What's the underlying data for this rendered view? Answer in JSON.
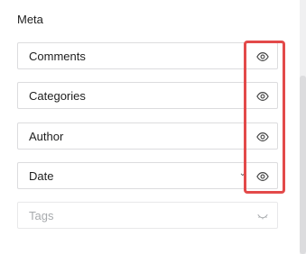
{
  "section": {
    "title": "Meta"
  },
  "fields": [
    {
      "label": "Comments",
      "icon": "eye-icon",
      "state": "visible"
    },
    {
      "label": "Categories",
      "icon": "eye-icon",
      "state": "visible"
    },
    {
      "label": "Author",
      "icon": "eye-icon",
      "state": "visible"
    },
    {
      "label": "Date",
      "icon": "eye-icon",
      "state": "visible",
      "has_dropdown": true
    },
    {
      "label": "Tags",
      "icon": "eye-closed-icon",
      "state": "hidden"
    }
  ],
  "colors": {
    "highlight": "#e34a4a",
    "border": "#dcdcde",
    "text": "#1e1e1e",
    "muted_text": "#a7aaad"
  }
}
